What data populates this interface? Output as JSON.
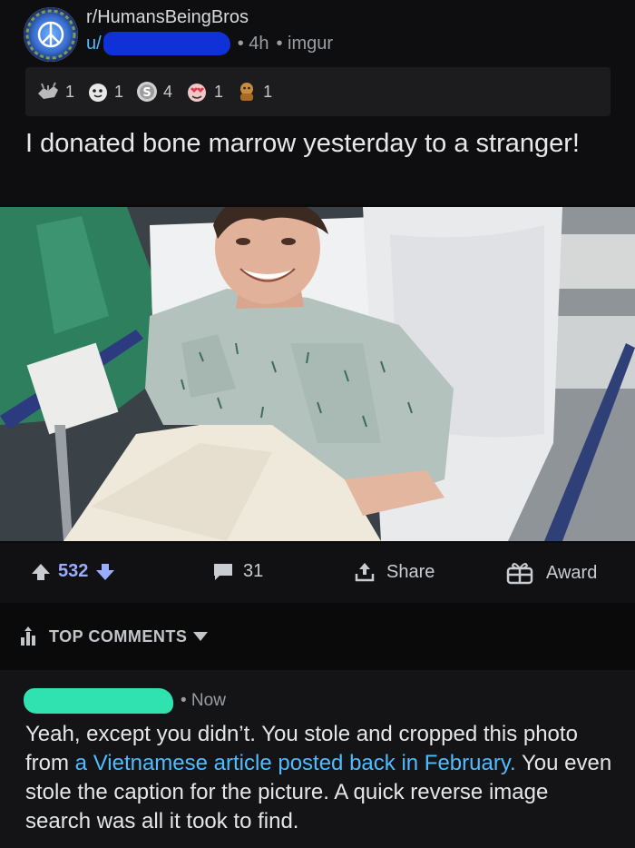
{
  "post": {
    "subreddit": "r/HumansBeingBros",
    "user_prefix": "u/",
    "age": "• 4h",
    "source": "• imgur",
    "title": "I donated bone marrow yesterday to a stranger!"
  },
  "awards": [
    {
      "icon": "wholesome-award-icon",
      "count": "1"
    },
    {
      "icon": "hugz-award-icon",
      "count": "1"
    },
    {
      "icon": "silver-award-icon",
      "count": "4"
    },
    {
      "icon": "heart-eyes-award-icon",
      "count": "1"
    },
    {
      "icon": "hug-award-icon",
      "count": "1"
    }
  ],
  "actions": {
    "votes": "532",
    "comments": "31",
    "share_label": "Share",
    "award_label": "Award"
  },
  "comments_section": {
    "header": "TOP COMMENTS"
  },
  "comment": {
    "time": "• Now",
    "text_part1": "Yeah, except you didn’t. You stole and cropped this photo from ",
    "link_text": "a Vietnamese article posted back in February.",
    "text_part2": " You even stole the caption for the picture. A quick reverse image search was all it took to find."
  },
  "colors": {
    "link": "#4fbcff",
    "vote_accent": "#9aaeff",
    "user_redaction": "#1030d8",
    "commenter_redaction": "#2fe2b0"
  }
}
